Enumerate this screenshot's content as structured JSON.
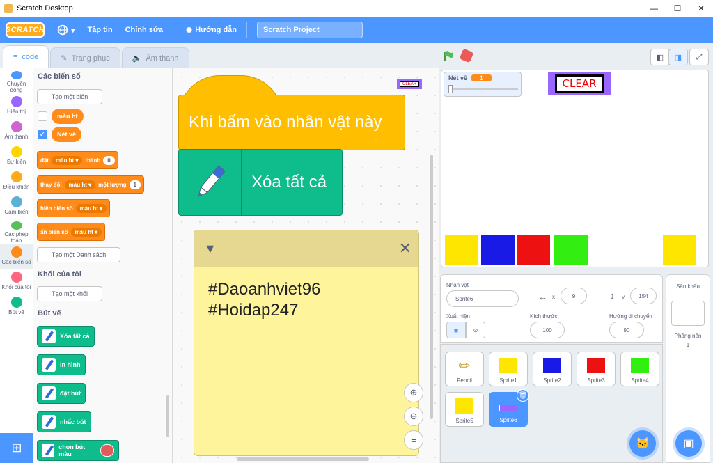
{
  "window": {
    "title": "Scratch Desktop",
    "controls": [
      "—",
      "☐",
      "✕"
    ]
  },
  "menubar": {
    "logo": "SCRATCH",
    "file": "Tập tin",
    "edit": "Chỉnh sửa",
    "tutorials": "Hướng dẫn",
    "project_title": "Scratch Project"
  },
  "tabs": {
    "code": "code",
    "costumes": "Trang phục",
    "sounds": "Âm thanh"
  },
  "categories": [
    {
      "label": "Chuyển động",
      "color": "#4c97ff"
    },
    {
      "label": "Hiển thị",
      "color": "#9966ff"
    },
    {
      "label": "Âm thanh",
      "color": "#cf63cf"
    },
    {
      "label": "Sự kiện",
      "color": "#ffd500"
    },
    {
      "label": "Điều khiển",
      "color": "#ffab19"
    },
    {
      "label": "Cảm biến",
      "color": "#5cb1d6"
    },
    {
      "label": "Các phép toán",
      "color": "#59c059"
    },
    {
      "label": "Các biến số",
      "color": "#ff8c1a"
    },
    {
      "label": "Khối của tôi",
      "color": "#ff6680"
    },
    {
      "label": "Bút vẽ",
      "color": "#0fbd8c"
    }
  ],
  "palette": {
    "variables_header": "Các biến số",
    "make_variable": "Tạo một biến",
    "var1": "màu ht",
    "var2": "Nét vẽ",
    "set": {
      "a": "đặt",
      "var": "màu ht",
      "b": "thành",
      "val": "0"
    },
    "change": {
      "a": "thay đổi",
      "var": "màu ht",
      "b": "một lượng",
      "val": "1"
    },
    "show": {
      "a": "hiện biến số",
      "var": "màu ht"
    },
    "hide": {
      "a": "ẩn biến số",
      "var": "màu ht"
    },
    "make_list": "Tạo một Danh sách",
    "myblocks_header": "Khối của tôi",
    "make_block": "Tạo một khối",
    "pen_header": "Bút vẽ",
    "pen_blocks": [
      "Xóa tất cả",
      "in hình",
      "đặt bút",
      "nhấc bút",
      "chọn bút màu"
    ]
  },
  "workspace": {
    "hat_label": "Khi bấm vào nhân vật này",
    "stack_label": "Xóa tất cả",
    "note_lines": [
      "#Daoanhviet96",
      "#Hoidap247"
    ],
    "mini_clear": "CLEAR"
  },
  "stage": {
    "monitor_label": "Nét vẽ",
    "monitor_value": "1",
    "clear_label": "CLEAR",
    "squares": [
      "#ffe600",
      "#1a1ae6",
      "#ee1111",
      "#33ee11",
      "#ffe600"
    ]
  },
  "sprite_info": {
    "sprite_label": "Nhân vật",
    "sprite_name": "Sprite6",
    "x_label": "x",
    "x_value": "9",
    "y_label": "y",
    "y_value": "154",
    "show_label": "Xuất hiện",
    "size_label": "Kích thước",
    "size_value": "100",
    "direction_label": "Hướng di chuyển",
    "direction_value": "90"
  },
  "sprites": [
    {
      "name": "Pencil",
      "color": ""
    },
    {
      "name": "Sprite1",
      "color": "#ffe600"
    },
    {
      "name": "Sprite2",
      "color": "#1a1ae6"
    },
    {
      "name": "Sprite3",
      "color": "#ee1111"
    },
    {
      "name": "Sprite4",
      "color": "#33ee11"
    },
    {
      "name": "Sprite5",
      "color": "#ffe600"
    },
    {
      "name": "Sprite6",
      "color": ""
    }
  ],
  "stage_panel": {
    "title": "Sân khấu",
    "backdrops_label": "Phông nền",
    "backdrops_count": "1"
  }
}
